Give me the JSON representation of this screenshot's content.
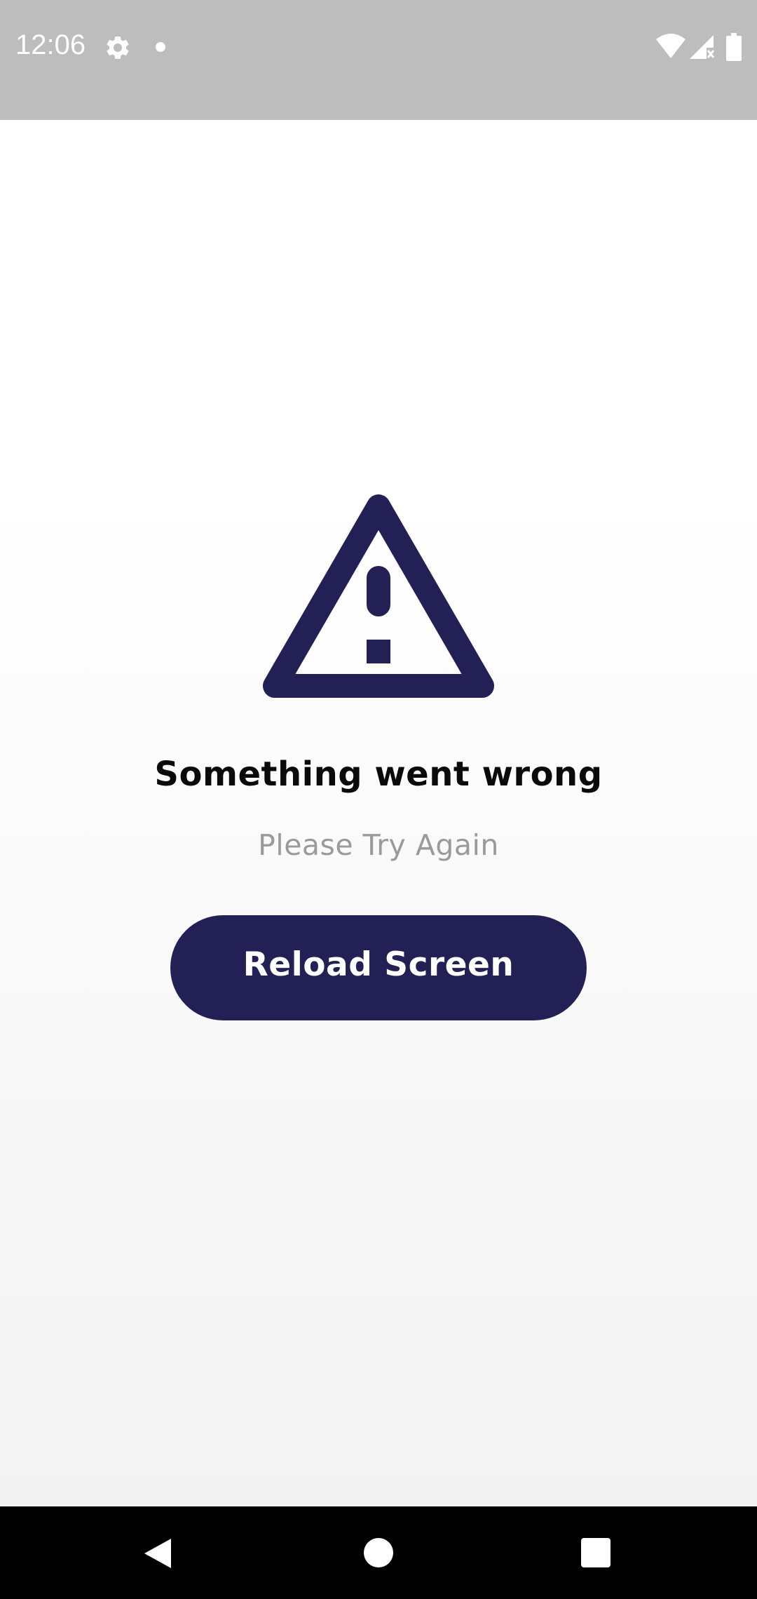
{
  "status_bar": {
    "time": "12:06",
    "icons": [
      "gear-icon",
      "notification-dot-icon",
      "wifi-icon",
      "signal-icon",
      "battery-icon"
    ]
  },
  "error": {
    "icon": "warning-triangle-icon",
    "title": "Something went wrong",
    "subtitle": "Please Try Again",
    "button_label": "Reload Screen"
  },
  "nav_bar": {
    "icons": [
      "back-icon",
      "home-icon",
      "recents-icon"
    ]
  },
  "colors": {
    "accent": "#222055",
    "status_bar_bg": "#bdbdbd",
    "title_text": "#0a0a0a",
    "subtitle_text": "#9a9a9a",
    "nav_bar_bg": "#000000"
  }
}
